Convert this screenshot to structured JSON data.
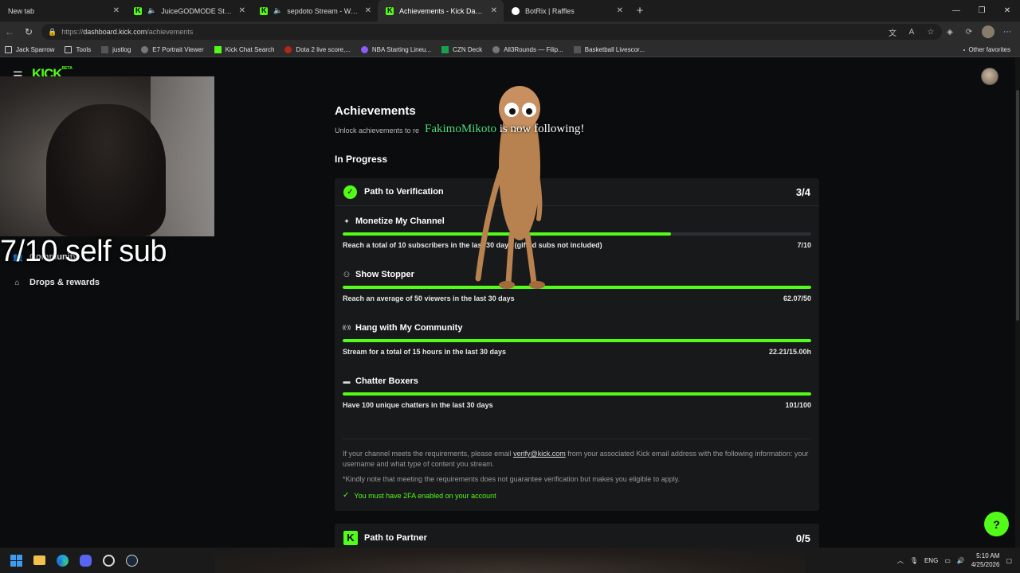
{
  "tabs": [
    {
      "label": "New tab",
      "icon": "page-icon",
      "audio": false,
      "active": false
    },
    {
      "label": "JuiceGODMODE Stream - Watch Live",
      "icon": "kick-icon",
      "audio": true,
      "active": false
    },
    {
      "label": "sepdoto Stream - Watch Live",
      "icon": "kick-icon",
      "audio": true,
      "active": false
    },
    {
      "label": "Achievements - Kick Dashboard",
      "icon": "kick-icon",
      "audio": false,
      "active": true
    },
    {
      "label": "BotRix | Raffles",
      "icon": "botrix-icon",
      "audio": false,
      "active": false
    }
  ],
  "address": {
    "scheme": "https://",
    "host": "dashboard.kick.com",
    "path": "/achievements"
  },
  "bookmarks": [
    {
      "label": "Jack Sparrow",
      "icon": "folder"
    },
    {
      "label": "Tools",
      "icon": "folder"
    },
    {
      "label": "justlog",
      "icon": "dark"
    },
    {
      "label": "E7 Portrait Viewer",
      "icon": "grey"
    },
    {
      "label": "Kick Chat Search",
      "icon": "kick"
    },
    {
      "label": "Dota 2 live score,...",
      "icon": "red"
    },
    {
      "label": "NBA Starting Lineu...",
      "icon": "purple"
    },
    {
      "label": "CZN Deck",
      "icon": "green"
    },
    {
      "label": "All3Rounds — Filip...",
      "icon": "grey"
    },
    {
      "label": "Basketball Livescor...",
      "icon": "dark"
    }
  ],
  "bookmarks_right": "Other favorites",
  "site": {
    "logo": "KICK",
    "logo_badge": "BETA"
  },
  "overlay": {
    "caption": "7/10 self sub",
    "follow_name": "FakimoMikoto",
    "follow_text": " is now following!"
  },
  "sidebar": [
    {
      "label": "Community",
      "icon": "community-icon",
      "expandable": true
    },
    {
      "label": "Drops & rewards",
      "icon": "drops-icon",
      "expandable": false
    }
  ],
  "main": {
    "title": "Achievements",
    "subtitle": "Unlock achievements to re",
    "section": "In Progress",
    "verification": {
      "title": "Path to Verification",
      "count": "3/4",
      "requirements": [
        {
          "title": "Monetize My Channel",
          "icon": "sparkle-icon",
          "desc": "Reach a total of 10 subscribers in the last 30 days (gifted subs not included)",
          "value": "7/10",
          "progress": 0.7
        },
        {
          "title": "Show Stopper",
          "icon": "people-icon",
          "desc": "Reach an average of 50 viewers in the last 30 days",
          "value": "62.07/50",
          "progress": 1.0
        },
        {
          "title": "Hang with My Community",
          "icon": "broadcast-icon",
          "desc": "Stream for a total of 15 hours in the last 30 days",
          "value": "22.21/15.00h",
          "progress": 1.0
        },
        {
          "title": "Chatter Boxers",
          "icon": "chat-icon",
          "desc": "Have 100 unique chatters in the last 30 days",
          "value": "101/100",
          "progress": 1.0
        }
      ],
      "info_pre": "If your channel meets the requirements, please email ",
      "info_email": "verify@kick.com",
      "info_post": " from your associated Kick email address with the following information: your username and what type of content you stream.",
      "note": "*Kindly note that meeting the requirements does not guarantee verification but makes you eligible to apply.",
      "twofa": "You must have 2FA enabled on your account"
    },
    "partner": {
      "title": "Path to Partner",
      "count": "0/5"
    }
  },
  "taskbar": {
    "language": "ENG",
    "time": "5:10 AM",
    "date": "4/25/2026"
  },
  "colors": {
    "accent": "#53fc18",
    "background": "#0b0c0d",
    "card": "#18191b"
  }
}
